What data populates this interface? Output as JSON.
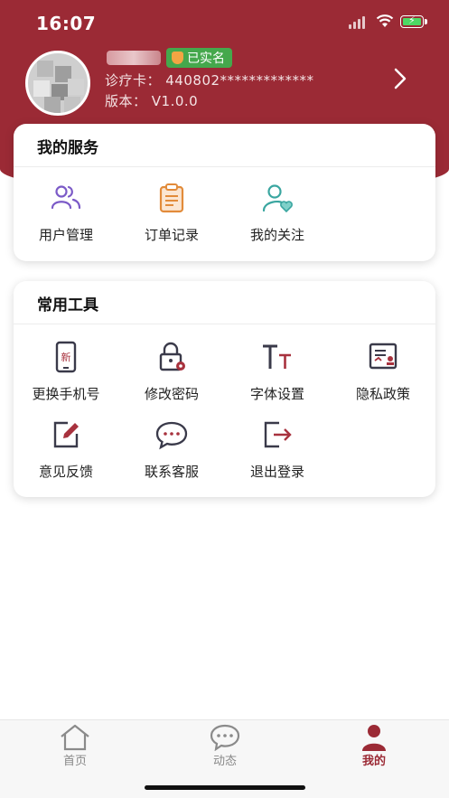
{
  "status_bar": {
    "time": "16:07"
  },
  "profile": {
    "verified_badge": "已实名",
    "card_line": "诊疗卡： 440802*************",
    "version_line": "版本： V1.0.0"
  },
  "services": {
    "title": "我的服务",
    "items": [
      {
        "label": "用户管理",
        "icon": "users-icon"
      },
      {
        "label": "订单记录",
        "icon": "clipboard-icon"
      },
      {
        "label": "我的关注",
        "icon": "user-heart-icon"
      }
    ]
  },
  "tools": {
    "title": "常用工具",
    "items": [
      {
        "label": "更换手机号",
        "icon": "phone-new-icon",
        "badge": "新"
      },
      {
        "label": "修改密码",
        "icon": "lock-gear-icon"
      },
      {
        "label": "字体设置",
        "icon": "font-size-icon",
        "glyph": "Tт"
      },
      {
        "label": "隐私政策",
        "icon": "document-policy-icon"
      },
      {
        "label": "意见反馈",
        "icon": "edit-feedback-icon"
      },
      {
        "label": "联系客服",
        "icon": "chat-bubble-icon"
      },
      {
        "label": "退出登录",
        "icon": "logout-icon"
      }
    ]
  },
  "tabbar": {
    "tabs": [
      {
        "label": "首页",
        "icon": "home-icon",
        "active": false
      },
      {
        "label": "动态",
        "icon": "chat-dots-icon",
        "active": false
      },
      {
        "label": "我的",
        "icon": "person-icon",
        "active": true
      }
    ]
  },
  "colors": {
    "brand": "#9b2a35",
    "accent_purple": "#7b5ac7",
    "accent_orange": "#e28b3a",
    "accent_teal": "#3aa6a0",
    "verified_green": "#45a84c"
  }
}
